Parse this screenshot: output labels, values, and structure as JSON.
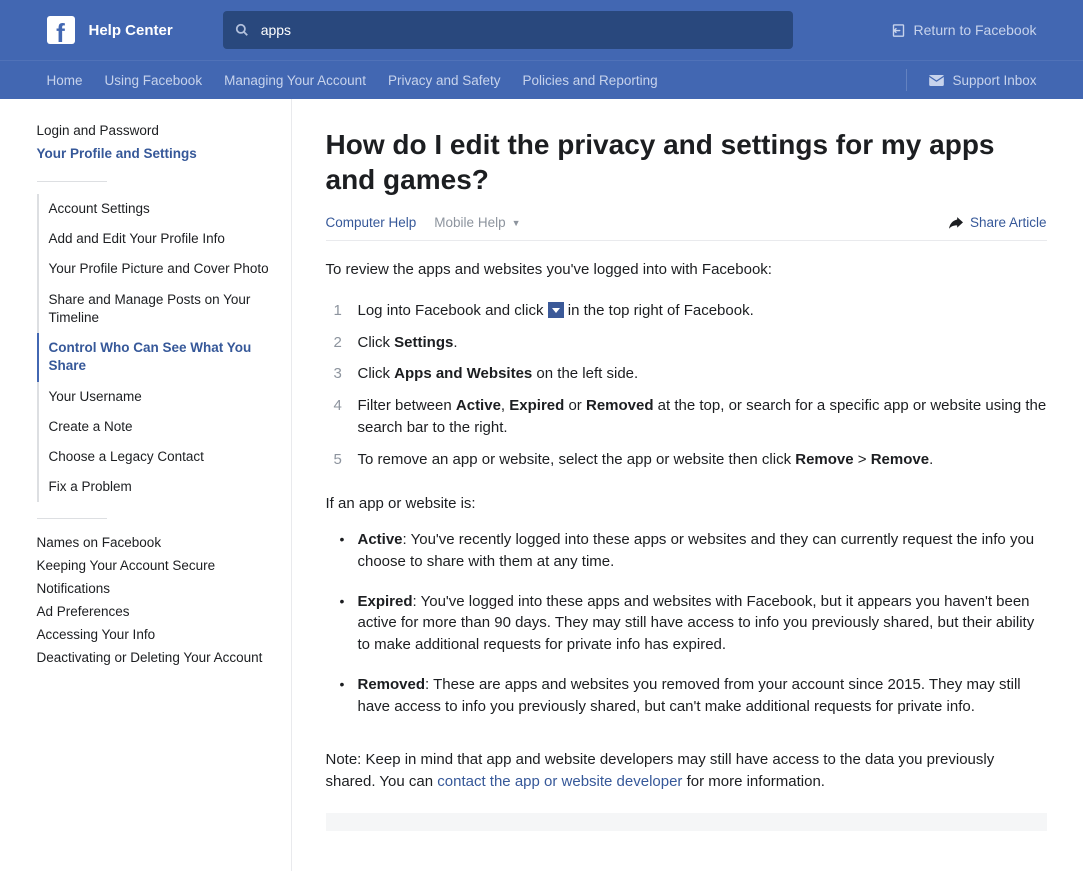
{
  "header": {
    "brand": "Help Center",
    "search_value": "apps",
    "return_label": "Return to Facebook"
  },
  "nav": {
    "items": [
      "Home",
      "Using Facebook",
      "Managing Your Account",
      "Privacy and Safety",
      "Policies and Reporting"
    ],
    "support": "Support Inbox"
  },
  "sidebar": {
    "top": [
      "Login and Password",
      "Your Profile and Settings"
    ],
    "sub": [
      "Account Settings",
      "Add and Edit Your Profile Info",
      "Your Profile Picture and Cover Photo",
      "Share and Manage Posts on Your Timeline",
      "Control Who Can See What You Share",
      "Your Username",
      "Create a Note",
      "Choose a Legacy Contact",
      "Fix a Problem"
    ],
    "active_sub_index": 4,
    "bottom": [
      "Names on Facebook",
      "Keeping Your Account Secure",
      "Notifications",
      "Ad Preferences",
      "Accessing Your Info",
      "Deactivating or Deleting Your Account"
    ]
  },
  "article": {
    "title": "How do I edit the privacy and settings for my apps and games?",
    "tabs": {
      "computer": "Computer Help",
      "mobile": "Mobile Help"
    },
    "share": "Share Article",
    "intro": "To review the apps and websites you've logged into with Facebook:",
    "steps": {
      "s1a": "Log into Facebook and click ",
      "s1b": " in the top right of Facebook.",
      "s2a": "Click ",
      "s2b": "Settings",
      "s2c": ".",
      "s3a": "Click ",
      "s3b": "Apps and Websites",
      "s3c": " on the left side.",
      "s4a": "Filter between ",
      "s4b": "Active",
      "s4c": ", ",
      "s4d": "Expired",
      "s4e": " or ",
      "s4f": "Removed",
      "s4g": " at the top, or search for a specific app or website using the search bar to the right.",
      "s5a": "To remove an app or website, select the app or website then click ",
      "s5b": "Remove",
      "s5c": " > ",
      "s5d": "Remove",
      "s5e": "."
    },
    "mid": "If an app or website is:",
    "bullets": {
      "b1t": "Active",
      "b1": ": You've recently logged into these apps or websites and they can currently request the info you choose to share with them at any time.",
      "b2t": "Expired",
      "b2": ": You've logged into these apps and websites with Facebook, but it appears you haven't been active for more than 90 days. They may still have access to info you previously shared, but their ability to make additional requests for private info has expired.",
      "b3t": "Removed",
      "b3": ": These are apps and websites you removed from your account since 2015. They may still have access to info you previously shared, but can't make additional requests for private info."
    },
    "note_a": "Note: Keep in mind that app and website developers may still have access to the data you previously shared. You can ",
    "note_link": "contact the app or website developer",
    "note_b": " for more information."
  }
}
